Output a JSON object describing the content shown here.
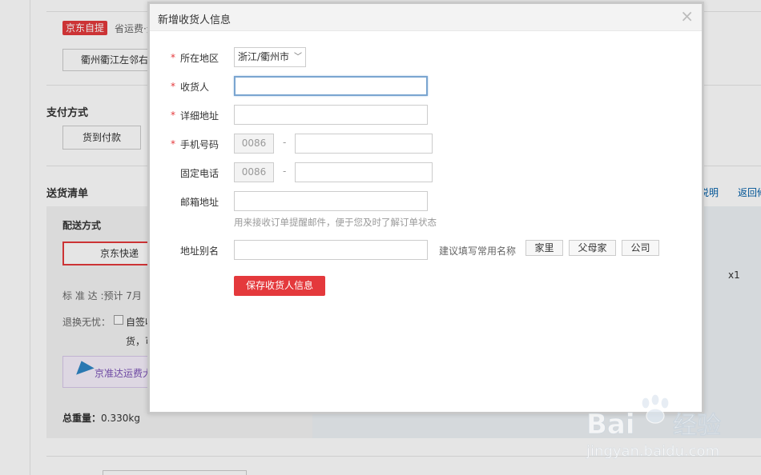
{
  "background": {
    "pickup_tag": "京东自提",
    "pickup_note": "省运费·无",
    "store_button": "衢州衢江左邻右舍",
    "payment_title": "支付方式",
    "payment_cod": "货到付款",
    "delivery_list_title": "送货清单",
    "delivery_method_label": "配送方式",
    "jd_express": "京东快递",
    "standard_arrival": "标 准 达 :预计 7月",
    "return_label": "退换无忧：",
    "return_text1": "自签收",
    "return_text2": "货，可",
    "promo_text": "京准达运费大",
    "total_weight_label": "总重量：",
    "total_weight_value": "0.330kg",
    "quantity": "x1",
    "right_link1": "说明",
    "right_link2": "返回修"
  },
  "modal": {
    "title": "新增收货人信息",
    "close_symbol": "×",
    "region": {
      "label": "所在地区",
      "value": "浙江/衢州市"
    },
    "consignee": {
      "label": "收货人",
      "value": ""
    },
    "address": {
      "label": "详细地址",
      "value": ""
    },
    "mobile": {
      "label": "手机号码",
      "code": "0086",
      "dash": "-",
      "value": ""
    },
    "phone": {
      "label": "固定电话",
      "code": "0086",
      "dash": "-",
      "value": ""
    },
    "email": {
      "label": "邮箱地址",
      "value": "",
      "hint": "用来接收订单提醒邮件，便于您及时了解订单状态"
    },
    "alias": {
      "label": "地址别名",
      "value": "",
      "suggest": "建议填写常用名称",
      "tags": [
        "家里",
        "父母家",
        "公司"
      ]
    },
    "required_mark": "*",
    "save_button": "保存收货人信息"
  },
  "watermark": {
    "brand": "Bai",
    "brand_suffix": "经验",
    "url": "jingyan.baidu.com"
  },
  "colors": {
    "accent": "#e4393c",
    "link": "#005ea7",
    "focus_border": "#7aa5d0"
  }
}
